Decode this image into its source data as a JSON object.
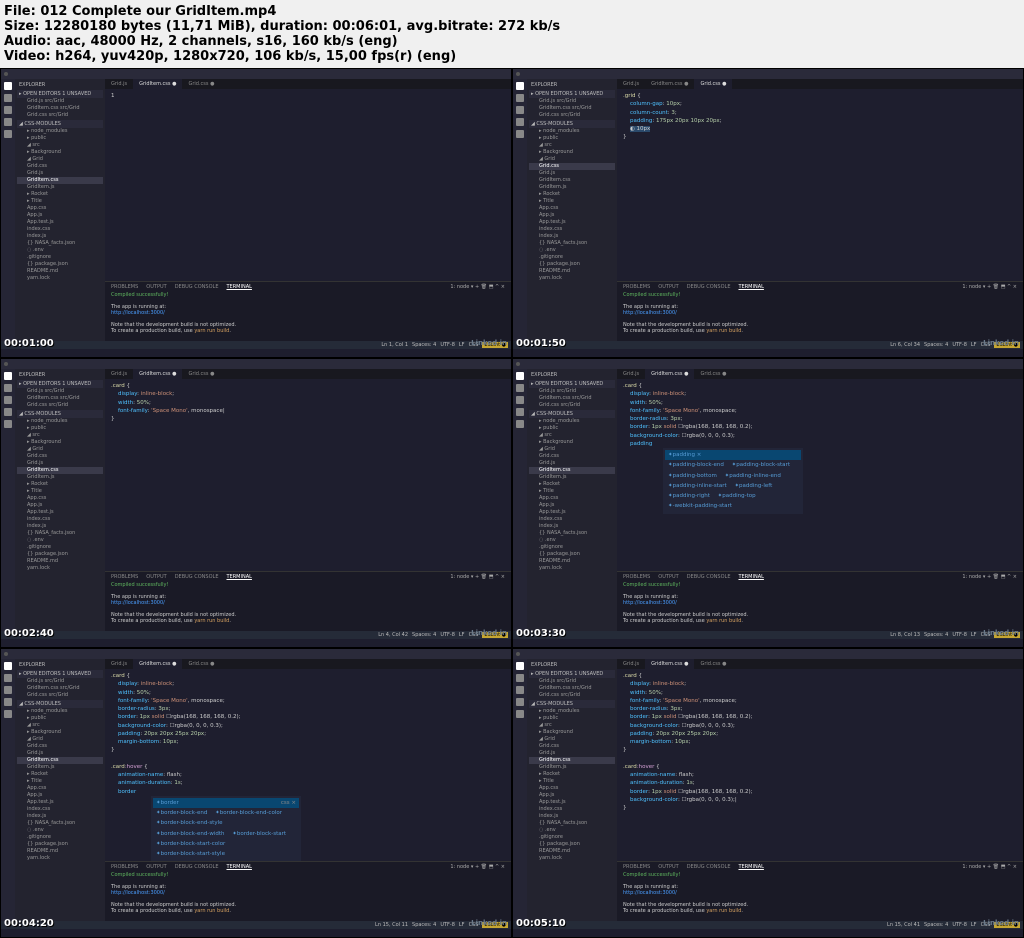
{
  "info": {
    "l1": "File: 012 Complete our GridItem.mp4",
    "l2": "Size: 12280180 bytes (11,71 MiB), duration: 00:06:01, avg.bitrate: 272 kb/s",
    "l3": "Audio: aac, 48000 Hz, 2 channels, s16, 160 kb/s (eng)",
    "l4": "Video: h264, yuv420p, 1280x720, 106 kb/s, 15,00 fps(r) (eng)"
  },
  "sidebar": {
    "explorer": "EXPLORER",
    "open_editors": "▸ OPEN EDITORS   1 UNSAVED",
    "oe": [
      "Grid.js  src/Grid",
      "GridItem.css  src/Grid",
      "Grid.css  src/Grid"
    ],
    "proj": "◢ CSS-MODULES",
    "items": [
      "▸ node_modules",
      "▸ public",
      "◢ src",
      "  ▸ Background",
      "  ◢ Grid",
      "    Grid.css",
      "    Grid.js",
      "    GridItem.css",
      "    GridItem.js",
      "  ▸ Rocket",
      "  ▸ Title",
      "  App.css",
      "  App.js",
      "  App.test.js",
      "  index.css",
      "  index.js",
      "{} NASA_facts.json",
      "◌ .env",
      ".gitignore",
      "{} package.json",
      "README.md",
      "yarn.lock"
    ]
  },
  "tabs": {
    "t1": "Grid.js",
    "t2": "GridItem.css",
    "t3": "Grid.css"
  },
  "panel": {
    "tabs": [
      "PROBLEMS",
      "OUTPUT",
      "DEBUG CONSOLE",
      "TERMINAL"
    ],
    "ok": "Compiled successfully!",
    "run": "The app is running at:",
    "url": "  http://localhost:3000/",
    "note1": "Note that the development build is not optimized.",
    "note2": "To create a production build, use ",
    "yarn": "yarn run build",
    "dot": ".",
    "node": "1: node"
  },
  "status": {
    "ln": "Ln 1, Col 1",
    "sp": "Spaces: 4",
    "enc": "UTF-8",
    "lf": "LF",
    "lang": "CSS",
    "es": "ESLint"
  },
  "wm": "Linked in",
  "shots": [
    {
      "ts": "00:01:00",
      "active_tab": "GridItem.css",
      "code": [],
      "status_ln": "Ln 1, Col 1"
    },
    {
      "ts": "00:01:50",
      "active_tab": "Grid.css",
      "code_grid": true,
      "status_ln": "Ln 6, Col 34"
    },
    {
      "ts": "00:02:40",
      "active_tab": "GridItem.css",
      "code": [
        ".card {",
        "    display: inline-block;",
        "    width: 50%;",
        "    font-family: 'Space Mono', monospace|",
        "",
        "}"
      ],
      "status_ln": "Ln 4, Col 42"
    },
    {
      "ts": "00:03:30",
      "active_tab": "GridItem.css",
      "autocomplete": true,
      "status_ln": "Ln 8, Col 13"
    },
    {
      "ts": "00:04:20",
      "active_tab": "GridItem.css",
      "code_hover": true,
      "status_ln": "Ln 15, Col 11"
    },
    {
      "ts": "00:05:10",
      "active_tab": "GridItem.css",
      "code_final": true,
      "status_ln": "Ln 15, Col 41"
    }
  ]
}
